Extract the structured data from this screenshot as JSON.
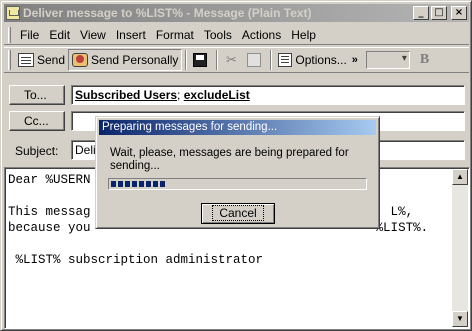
{
  "window": {
    "title": "Deliver message to %LIST% - Message (Plain Text)",
    "controls": {
      "minimize": "_",
      "maximize": "□",
      "close": "×"
    }
  },
  "menu": {
    "items": [
      {
        "label": "File"
      },
      {
        "label": "Edit"
      },
      {
        "label": "View"
      },
      {
        "label": "Insert"
      },
      {
        "label": "Format"
      },
      {
        "label": "Tools"
      },
      {
        "label": "Actions"
      },
      {
        "label": "Help"
      }
    ]
  },
  "toolbar": {
    "send": "Send",
    "send_personally": "Send Personally",
    "options": "Options...",
    "chevron": "»",
    "bold": "B"
  },
  "to": {
    "button": "To...",
    "recipients": [
      "Subscribed Users",
      "excludeList"
    ],
    "separator": "; "
  },
  "cc": {
    "button": "Cc...",
    "value": ""
  },
  "subject": {
    "label": "Subject:",
    "value": "Deliv"
  },
  "body": {
    "line1": "Dear %USERN",
    "line2": "",
    "line3": "This messag                                        L%,",
    "line4": "because you                                      %LIST%.",
    "line5": "",
    "line6": " %LIST% subscription administrator"
  },
  "dialog": {
    "title": "Preparing messages for sending...",
    "message": "Wait, please, messages are being prepared for sending...",
    "progress_fraction": 0.22,
    "cancel": "Cancel"
  }
}
